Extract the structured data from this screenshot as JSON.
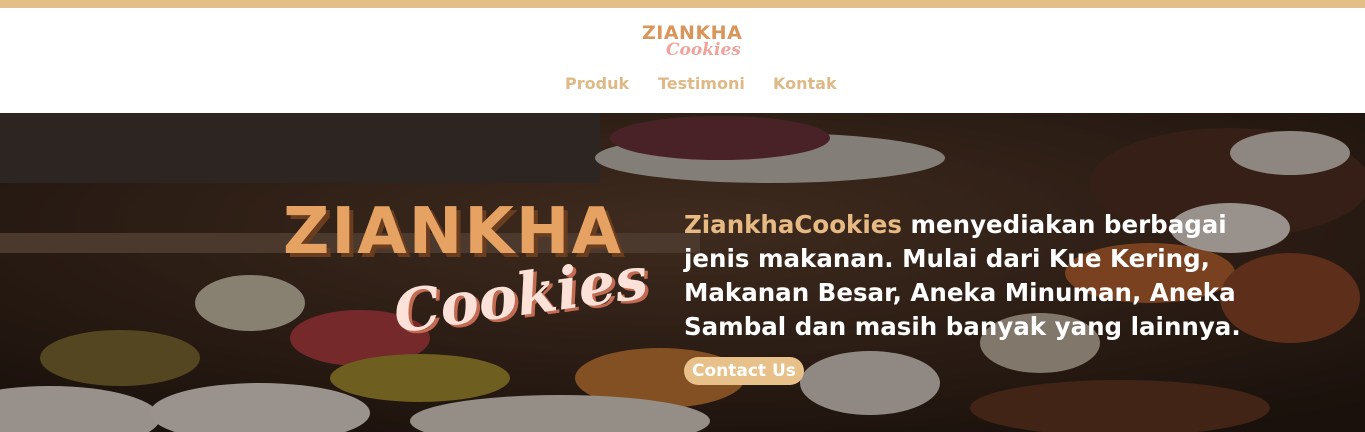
{
  "colors": {
    "accent": "#e3bf87",
    "nav_text": "#dfb985",
    "brand_orange": "#e6a262",
    "brand_pink": "#fbe1d8",
    "button_bg": "#e8c08a"
  },
  "header": {
    "logo": {
      "line1": "ZIANKHA",
      "line2": "Cookies"
    },
    "nav": [
      {
        "label": "Produk"
      },
      {
        "label": "Testimoni"
      },
      {
        "label": "Kontak"
      }
    ]
  },
  "hero": {
    "logo": {
      "line1": "ZIANKHA",
      "line2": "Cookies"
    },
    "brand_name": "ZiankhaCookies",
    "description": " menyediakan berbagai jenis makanan. Mulai dari Kue Kering, Makanan Besar, Aneka Minuman, Aneka Sambal dan masih banyak yang lainnya.",
    "cta_label": "Contact Us"
  }
}
